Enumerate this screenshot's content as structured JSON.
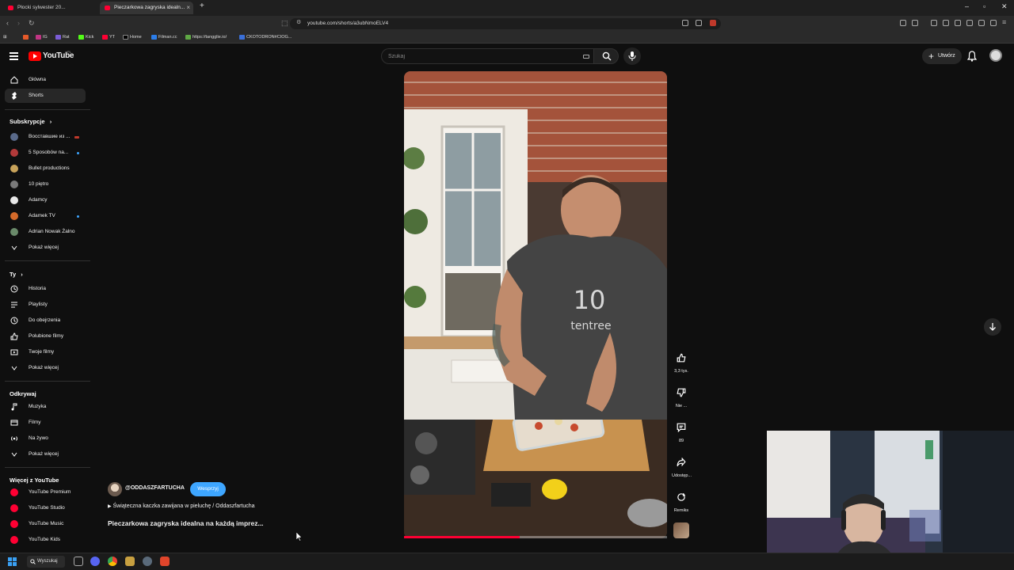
{
  "browser": {
    "tabs": [
      {
        "title": "Płocki sylwester 20..."
      },
      {
        "title": "Pieczarkowa zagryska idealn..."
      }
    ],
    "new_tab": "+",
    "url": "youtube.com/shorts/a3ubNmoELV4",
    "bookmarks": [
      "IG",
      "Rat",
      "Kick",
      "YT",
      "Home",
      "Filman.cc",
      "https://tangglie.io/",
      "CKOTODRON#CIOG..."
    ]
  },
  "youtube": {
    "logo_text": "YouTube",
    "logo_country": "PL",
    "search_placeholder": "Szukaj",
    "create_label": "Utwórz"
  },
  "sidebar": {
    "main": [
      {
        "label": "Główna",
        "icon": "home-icon"
      },
      {
        "label": "Shorts",
        "icon": "shorts-icon",
        "active": true
      }
    ],
    "subscriptions_title": "Subskrypcje",
    "subscriptions": [
      {
        "label": "Восставшие из ...",
        "color": "#5a6a8a",
        "badge": "live"
      },
      {
        "label": "5 Sposobów na...",
        "color": "#b23a3a",
        "badge": "dot"
      },
      {
        "label": "Bullet productions",
        "color": "#c8a35a"
      },
      {
        "label": "10 piętro",
        "color": "#7a7a7a"
      },
      {
        "label": "Adamcy",
        "color": "#e8e8e8"
      },
      {
        "label": "Adamek TV",
        "color": "#d46a2a",
        "badge": "dot"
      },
      {
        "label": "Adrian Nowak Żalno",
        "color": "#6a8a6a"
      }
    ],
    "show_more": "Pokaż więcej",
    "you_title": "Ty",
    "you": [
      {
        "label": "Historia",
        "icon": "history-icon"
      },
      {
        "label": "Playlisty",
        "icon": "playlist-icon"
      },
      {
        "label": "Do obejrzenia",
        "icon": "watch-later-icon"
      },
      {
        "label": "Polubione filmy",
        "icon": "like-icon"
      },
      {
        "label": "Twoje filmy",
        "icon": "your-videos-icon"
      }
    ],
    "explore_title": "Odkrywaj",
    "explore": [
      {
        "label": "Muzyka",
        "icon": "music-icon"
      },
      {
        "label": "Filmy",
        "icon": "movies-icon"
      },
      {
        "label": "Na żywo",
        "icon": "live-icon"
      }
    ],
    "more_title": "Więcej z YouTube",
    "more": [
      {
        "label": "YouTube Premium"
      },
      {
        "label": "YouTube Studio"
      },
      {
        "label": "YouTube Music"
      },
      {
        "label": "YouTube Kids"
      }
    ]
  },
  "short": {
    "channel": "@ODDASZFARTUCHA",
    "support_label": "Wesprzyj",
    "playlist": "Świąteczna kaczka zawijana w pieluchę / Oddaszfartucha",
    "title": "Pieczarkowa zagryska idealna na każdą imprez...",
    "progress": 0.44,
    "shirt_text_top": "10",
    "shirt_text_bottom": "tentree",
    "actions": {
      "like_count": "3,3 tys.",
      "dislike_label": "Nie ...",
      "comments_count": "89",
      "share_label": "Udostęp...",
      "remix_label": "Remiks"
    }
  },
  "taskbar": {
    "search_label": "Wyszukaj"
  },
  "colors": {
    "accent": "#ff0033",
    "support": "#3ea6ff",
    "bg": "#0f0f0f"
  }
}
